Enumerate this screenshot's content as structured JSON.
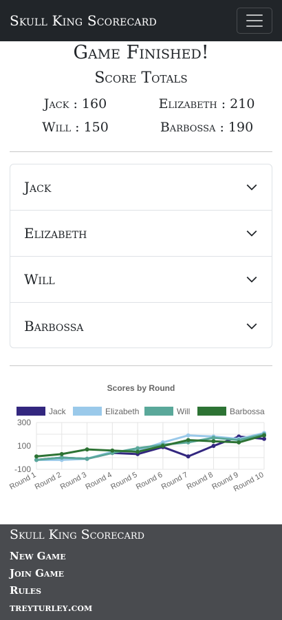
{
  "navbar": {
    "brand": "Skull King Scorecard"
  },
  "main": {
    "title": "Game Finished!",
    "subtitle": "Score Totals",
    "totals": [
      {
        "text": "Jack : 160"
      },
      {
        "text": "Elizabeth : 210"
      },
      {
        "text": "Will : 150"
      },
      {
        "text": "Barbossa : 190"
      }
    ]
  },
  "accordion": {
    "items": [
      {
        "label": "Jack"
      },
      {
        "label": "Elizabeth"
      },
      {
        "label": "Will"
      },
      {
        "label": "Barbossa"
      }
    ]
  },
  "chart_data": {
    "type": "line",
    "title": "Scores by Round",
    "categories": [
      "Round 1",
      "Round 2",
      "Round 3",
      "Round 4",
      "Round 5",
      "Round 6",
      "Round 7",
      "Round 8",
      "Round 9",
      "Round 10"
    ],
    "y_ticks": [
      "300",
      "100",
      "-100"
    ],
    "ylim": [
      -100,
      300
    ],
    "grid": true,
    "legend_position": "top",
    "series": [
      {
        "name": "Jack",
        "color": "#33277f",
        "values": [
          -20,
          0,
          -10,
          40,
          30,
          90,
          10,
          100,
          180,
          160
        ]
      },
      {
        "name": "Elizabeth",
        "color": "#9ac9ea",
        "values": [
          -20,
          -20,
          -10,
          50,
          60,
          130,
          190,
          180,
          160,
          210
        ]
      },
      {
        "name": "Will",
        "color": "#5aa89a",
        "values": [
          -20,
          0,
          -10,
          40,
          80,
          110,
          130,
          170,
          150,
          200
        ]
      },
      {
        "name": "Barbossa",
        "color": "#2d7334",
        "values": [
          10,
          30,
          70,
          60,
          50,
          100,
          150,
          140,
          130,
          190
        ]
      }
    ]
  },
  "footer": {
    "title": "Skull King Scorecard",
    "links": [
      {
        "label": "New Game"
      },
      {
        "label": "Join Game"
      },
      {
        "label": "Rules"
      },
      {
        "label": "treyturley.com"
      }
    ]
  }
}
